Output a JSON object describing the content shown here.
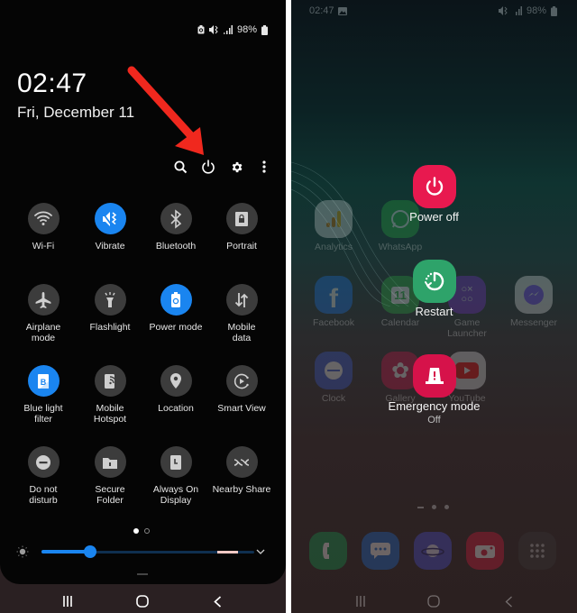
{
  "left_panel": {
    "status_bar": {
      "battery": "98%",
      "icons": [
        "power-saving-icon",
        "vibrate-icon",
        "signal-icon",
        "battery-icon"
      ]
    },
    "clock": "02:47",
    "date": "Fri, December 11",
    "actions": [
      {
        "name": "search",
        "icon": "search-icon"
      },
      {
        "name": "power",
        "icon": "power-icon"
      },
      {
        "name": "settings",
        "icon": "gear-icon"
      },
      {
        "name": "more",
        "icon": "more-vertical-icon"
      }
    ],
    "annotation": {
      "type": "arrow",
      "color": "#f0281e",
      "points_to": "power"
    },
    "tiles": [
      {
        "label": "Wi-Fi",
        "icon": "wifi-icon",
        "on": false
      },
      {
        "label": "Vibrate",
        "icon": "vibrate-icon",
        "on": true
      },
      {
        "label": "Bluetooth",
        "icon": "bluetooth-icon",
        "on": false
      },
      {
        "label": "Portrait",
        "icon": "portrait-lock-icon",
        "on": false
      },
      {
        "label": "Airplane\nmode",
        "icon": "airplane-icon",
        "on": false
      },
      {
        "label": "Flashlight",
        "icon": "flashlight-icon",
        "on": false
      },
      {
        "label": "Power mode",
        "icon": "power-mode-icon",
        "on": true
      },
      {
        "label": "Mobile\ndata",
        "icon": "mobile-data-icon",
        "on": false
      },
      {
        "label": "Blue light\nfilter",
        "icon": "blue-light-icon",
        "on": true
      },
      {
        "label": "Mobile\nHotspot",
        "icon": "hotspot-icon",
        "on": false
      },
      {
        "label": "Location",
        "icon": "location-icon",
        "on": false
      },
      {
        "label": "Smart View",
        "icon": "smart-view-icon",
        "on": false
      },
      {
        "label": "Do not\ndisturb",
        "icon": "do-not-disturb-icon",
        "on": false
      },
      {
        "label": "Secure\nFolder",
        "icon": "secure-folder-icon",
        "on": false
      },
      {
        "label": "Always On\nDisplay",
        "icon": "always-on-display-icon",
        "on": false
      },
      {
        "label": "Nearby Share",
        "icon": "nearby-share-icon",
        "on": false
      }
    ],
    "page_indicator": {
      "current": 1,
      "total": 2
    },
    "brightness": {
      "level_fraction": 0.23
    },
    "accent_color": "#1a85f0"
  },
  "right_panel": {
    "status_bar": {
      "time": "02:47",
      "battery": "98%"
    },
    "apps": [
      {
        "name": "Analytics"
      },
      {
        "name": "WhatsApp"
      },
      {
        "name": "Facebook"
      },
      {
        "name": "Calendar",
        "badge": "11"
      },
      {
        "name": "Game\nLauncher"
      },
      {
        "name": "Messenger"
      },
      {
        "name": "Clock"
      },
      {
        "name": "Gallery"
      },
      {
        "name": "YouTube"
      }
    ],
    "dock": [
      "Phone",
      "Messages",
      "Internet",
      "Camera",
      "Apps"
    ],
    "power_menu": [
      {
        "label": "Power off",
        "color": "#e8194f",
        "icon": "power-icon"
      },
      {
        "label": "Restart",
        "color": "#2ea36a",
        "icon": "restart-icon"
      },
      {
        "label": "Emergency mode",
        "sublabel": "Off",
        "color": "#d6124a",
        "icon": "emergency-icon"
      }
    ]
  }
}
